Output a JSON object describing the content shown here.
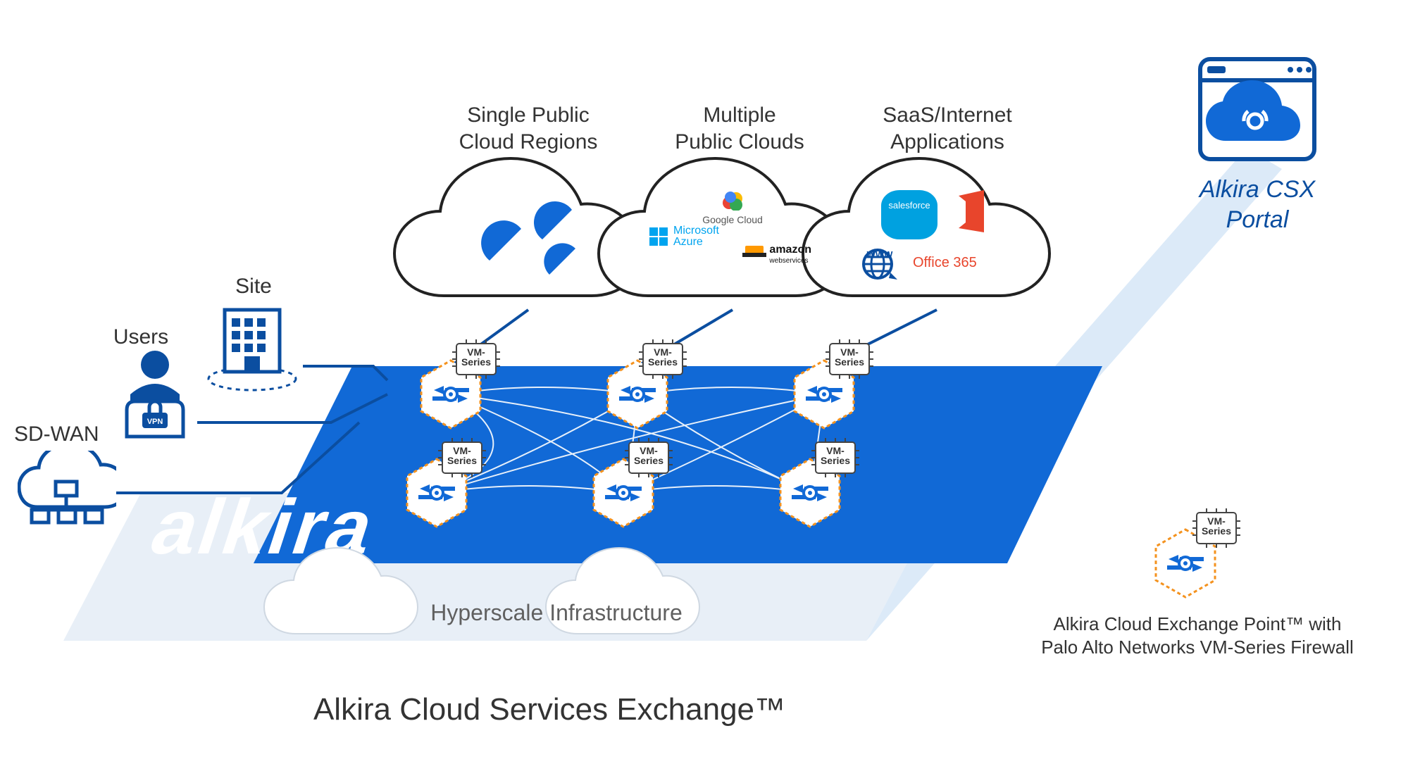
{
  "labels": {
    "single_public_cloud": "Single Public\nCloud Regions",
    "multiple_public_clouds": "Multiple\nPublic Clouds",
    "saas_internet": "SaaS/Internet\nApplications",
    "site": "Site",
    "users": "Users",
    "sdwan": "SD-WAN",
    "portal": "Alkira CSX\nPortal",
    "hyperscale": "Hyperscale Infrastructure",
    "legend": "Alkira Cloud Exchange Point™ with\nPalo Alto Networks VM-Series Firewall",
    "title": "Alkira Cloud Services Exchange™",
    "vm_series": "VM-\nSeries",
    "brand": "alkira"
  },
  "cloud_contents": {
    "multi_google": "Google Cloud",
    "multi_azure1": "Microsoft",
    "multi_azure2": "Azure",
    "multi_aws1": "amazon",
    "multi_aws2": "webservices",
    "saas_sf": "salesforce",
    "saas_www": "WWW",
    "saas_o365": "Office 365"
  },
  "colors": {
    "brand_blue": "#1169d6",
    "dark_blue": "#0b4ea0",
    "orange": "#f4921e",
    "light_blue": "#bed7f0",
    "pale_blue": "#e4eef9",
    "text": "#333333"
  }
}
